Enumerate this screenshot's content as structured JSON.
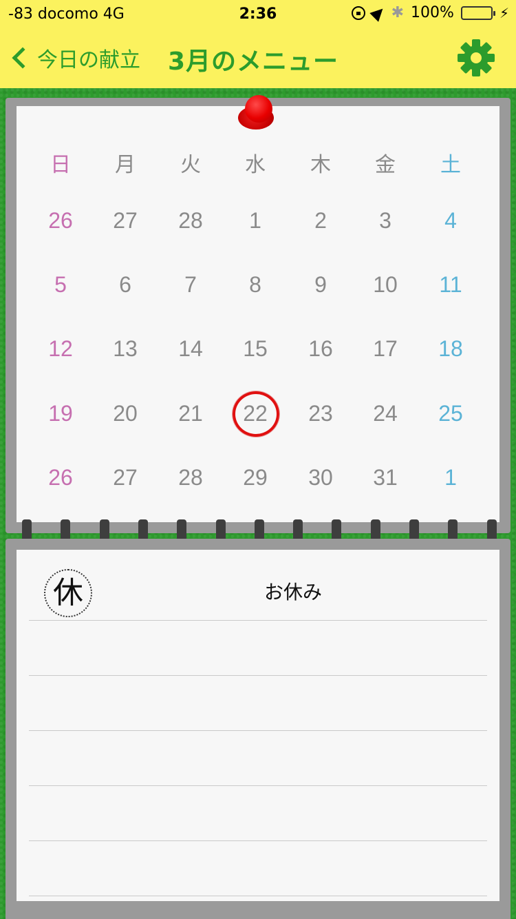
{
  "status_bar": {
    "carrier": "-83 docomo   4G",
    "time": "2:36",
    "battery": "100%"
  },
  "nav": {
    "back_label": "今日の献立",
    "title": "3月のメニュー",
    "settings_icon": "gear-icon"
  },
  "colors": {
    "topbar": "#fbf25e",
    "accent_green": "#2c9c2c",
    "sunday": "#c66fb0",
    "saturday": "#5bb3d6",
    "today_ring": "#e01010"
  },
  "calendar": {
    "weekdays": [
      "日",
      "月",
      "火",
      "水",
      "木",
      "金",
      "土"
    ],
    "weeks": [
      [
        "26",
        "27",
        "28",
        "1",
        "2",
        "3",
        "4"
      ],
      [
        "5",
        "6",
        "7",
        "8",
        "9",
        "10",
        "11"
      ],
      [
        "12",
        "13",
        "14",
        "15",
        "16",
        "17",
        "18"
      ],
      [
        "19",
        "20",
        "21",
        "22",
        "23",
        "24",
        "25"
      ],
      [
        "26",
        "27",
        "28",
        "29",
        "30",
        "31",
        "1"
      ]
    ],
    "today": "22"
  },
  "menu": {
    "badge": "休",
    "item": "お休み"
  }
}
